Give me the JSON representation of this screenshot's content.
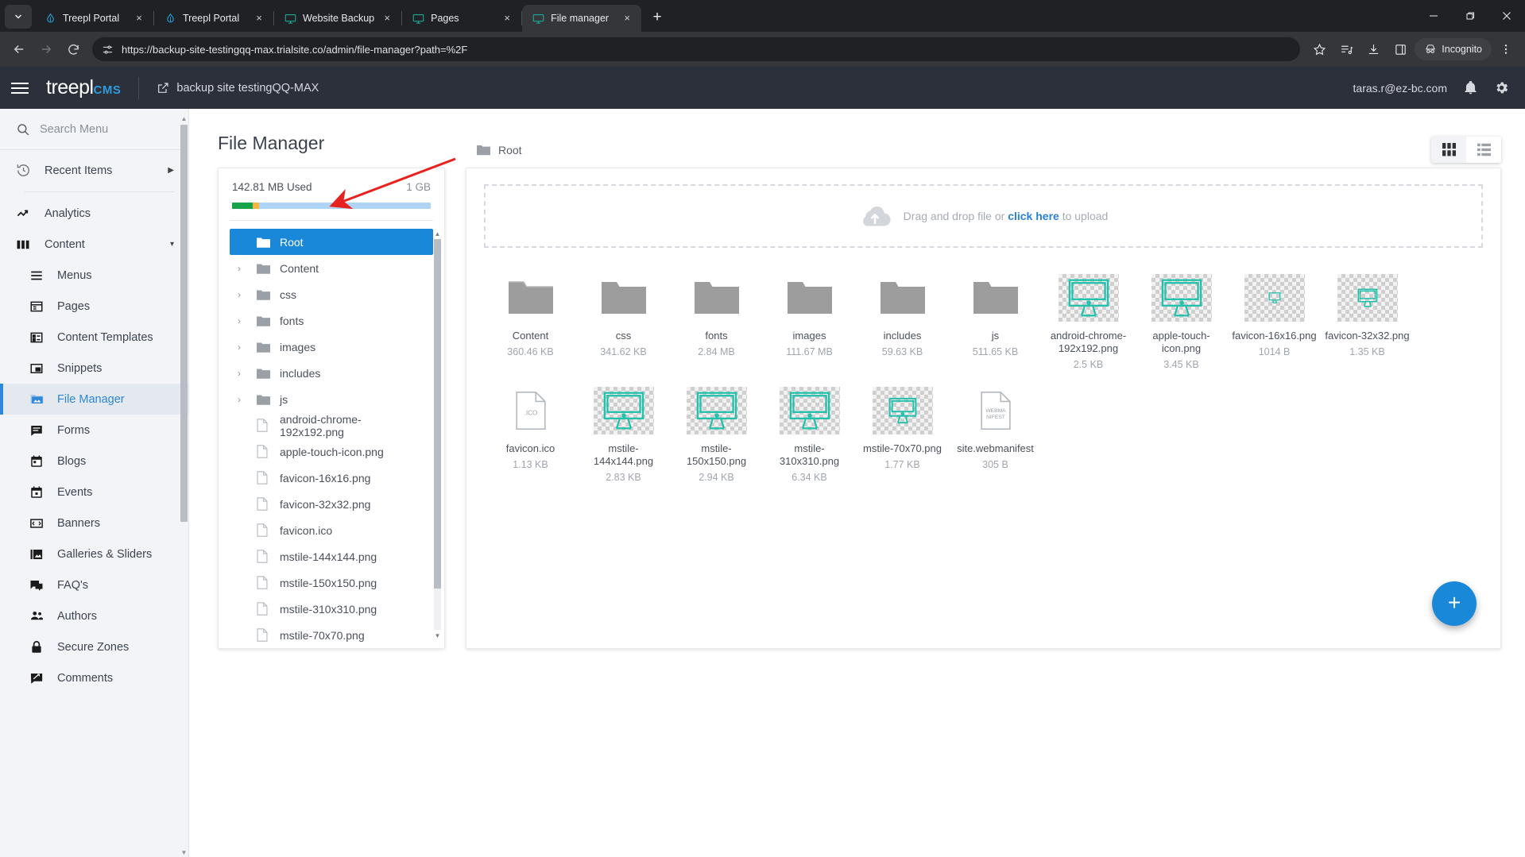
{
  "browser": {
    "tabs": [
      {
        "title": "Treepl Portal",
        "icon": "treepl-favicon",
        "active": false
      },
      {
        "title": "Treepl Portal",
        "icon": "treepl-favicon",
        "active": false
      },
      {
        "title": "Website Backup",
        "icon": "monitor-favicon",
        "active": false
      },
      {
        "title": "Pages",
        "icon": "monitor-favicon",
        "active": false
      },
      {
        "title": "File manager",
        "icon": "monitor-favicon",
        "active": true
      }
    ],
    "new_tab_label": "+",
    "close_label": "×",
    "url": "https://backup-site-testingqq-max.trialsite.co/admin/file-manager?path=%2F",
    "incognito_label": "Incognito",
    "window": {
      "minimize": "—",
      "maximize": "❐",
      "close": "✕"
    }
  },
  "header": {
    "logo_main": "treepl",
    "logo_sub": "CMS",
    "site_name": "backup site testingQQ-MAX",
    "user_email": "taras.r@ez-bc.com"
  },
  "sidebar": {
    "search_placeholder": "Search Menu",
    "search_value": "",
    "recent_items": "Recent Items",
    "items": [
      {
        "label": "Analytics",
        "icon": "analytics-icon",
        "sub": false,
        "active": false
      },
      {
        "label": "Content",
        "icon": "content-icon",
        "sub": false,
        "active": false,
        "expanded": true
      },
      {
        "label": "Menus",
        "icon": "menus-icon",
        "sub": true,
        "active": false
      },
      {
        "label": "Pages",
        "icon": "pages-icon",
        "sub": true,
        "active": false
      },
      {
        "label": "Content Templates",
        "icon": "content-templates-icon",
        "sub": true,
        "active": false
      },
      {
        "label": "Snippets",
        "icon": "snippets-icon",
        "sub": true,
        "active": false
      },
      {
        "label": "File Manager",
        "icon": "file-manager-icon",
        "sub": true,
        "active": true
      },
      {
        "label": "Forms",
        "icon": "forms-icon",
        "sub": true,
        "active": false
      },
      {
        "label": "Blogs",
        "icon": "blogs-icon",
        "sub": true,
        "active": false
      },
      {
        "label": "Events",
        "icon": "events-icon",
        "sub": true,
        "active": false
      },
      {
        "label": "Banners",
        "icon": "banners-icon",
        "sub": true,
        "active": false
      },
      {
        "label": "Galleries & Sliders",
        "icon": "galleries-icon",
        "sub": true,
        "active": false
      },
      {
        "label": "FAQ's",
        "icon": "faq-icon",
        "sub": true,
        "active": false
      },
      {
        "label": "Authors",
        "icon": "authors-icon",
        "sub": true,
        "active": false
      },
      {
        "label": "Secure Zones",
        "icon": "secure-zones-icon",
        "sub": true,
        "active": false
      },
      {
        "label": "Comments",
        "icon": "comments-icon",
        "sub": true,
        "active": false
      }
    ]
  },
  "page": {
    "title": "File Manager",
    "breadcrumb": "Root",
    "view_mode": "grid"
  },
  "storage": {
    "used_label": "142.81 MB Used",
    "total_label": "1 GB",
    "used_percent": 14.3,
    "segments": [
      {
        "color": "#16a34a",
        "percent": 10.5
      },
      {
        "color": "#f5b545",
        "percent": 3.2
      },
      {
        "color": "#aed4f7",
        "percent": 86.3
      }
    ]
  },
  "tree": {
    "nodes": [
      {
        "label": "Root",
        "type": "folder",
        "selected": true,
        "expandable": false
      },
      {
        "label": "Content",
        "type": "folder",
        "selected": false,
        "expandable": true
      },
      {
        "label": "css",
        "type": "folder",
        "selected": false,
        "expandable": true
      },
      {
        "label": "fonts",
        "type": "folder",
        "selected": false,
        "expandable": true
      },
      {
        "label": "images",
        "type": "folder",
        "selected": false,
        "expandable": true
      },
      {
        "label": "includes",
        "type": "folder",
        "selected": false,
        "expandable": true
      },
      {
        "label": "js",
        "type": "folder",
        "selected": false,
        "expandable": true
      },
      {
        "label": "android-chrome-192x192.png",
        "type": "file",
        "selected": false,
        "expandable": false
      },
      {
        "label": "apple-touch-icon.png",
        "type": "file",
        "selected": false,
        "expandable": false
      },
      {
        "label": "favicon-16x16.png",
        "type": "file",
        "selected": false,
        "expandable": false
      },
      {
        "label": "favicon-32x32.png",
        "type": "file",
        "selected": false,
        "expandable": false
      },
      {
        "label": "favicon.ico",
        "type": "file",
        "selected": false,
        "expandable": false
      },
      {
        "label": "mstile-144x144.png",
        "type": "file",
        "selected": false,
        "expandable": false
      },
      {
        "label": "mstile-150x150.png",
        "type": "file",
        "selected": false,
        "expandable": false
      },
      {
        "label": "mstile-310x310.png",
        "type": "file",
        "selected": false,
        "expandable": false
      },
      {
        "label": "mstile-70x70.png",
        "type": "file",
        "selected": false,
        "expandable": false
      }
    ]
  },
  "dropzone": {
    "text_before": "Drag and drop file or ",
    "link": "click here",
    "text_after": " to upload"
  },
  "files": [
    {
      "name": "Content",
      "size": "360.46 KB",
      "kind": "folder"
    },
    {
      "name": "css",
      "size": "341.62 KB",
      "kind": "folder"
    },
    {
      "name": "fonts",
      "size": "2.84 MB",
      "kind": "folder"
    },
    {
      "name": "images",
      "size": "111.67 MB",
      "kind": "folder"
    },
    {
      "name": "includes",
      "size": "59.63 KB",
      "kind": "folder"
    },
    {
      "name": "js",
      "size": "511.65 KB",
      "kind": "folder"
    },
    {
      "name": "android-chrome-192x192.png",
      "size": "2.5 KB",
      "kind": "image",
      "thumb": "monitor-large"
    },
    {
      "name": "apple-touch-icon.png",
      "size": "3.45 KB",
      "kind": "image",
      "thumb": "monitor-large"
    },
    {
      "name": "favicon-16x16.png",
      "size": "1014 B",
      "kind": "image",
      "thumb": "monitor-tiny"
    },
    {
      "name": "favicon-32x32.png",
      "size": "1.35 KB",
      "kind": "image",
      "thumb": "monitor-small"
    },
    {
      "name": "favicon.ico",
      "size": "1.13 KB",
      "kind": "doc",
      "ext": ".ICO"
    },
    {
      "name": "mstile-144x144.png",
      "size": "2.83 KB",
      "kind": "image",
      "thumb": "monitor-large"
    },
    {
      "name": "mstile-150x150.png",
      "size": "2.94 KB",
      "kind": "image",
      "thumb": "monitor-large"
    },
    {
      "name": "mstile-310x310.png",
      "size": "6.34 KB",
      "kind": "image",
      "thumb": "monitor-large"
    },
    {
      "name": "mstile-70x70.png",
      "size": "1.77 KB",
      "kind": "image",
      "thumb": "monitor-medium"
    },
    {
      "name": "site.webmanifest",
      "size": "305 B",
      "kind": "doc",
      "ext": "WEBMANIFEST"
    }
  ],
  "fab": {
    "label": "+"
  },
  "annotation": {
    "type": "red-arrow",
    "color": "#e8231f"
  },
  "colors": {
    "accent": "#1a88d8",
    "teal": "#21c1ab",
    "header_bg": "#2b303b",
    "sidebar_bg": "#f2f4f8"
  }
}
